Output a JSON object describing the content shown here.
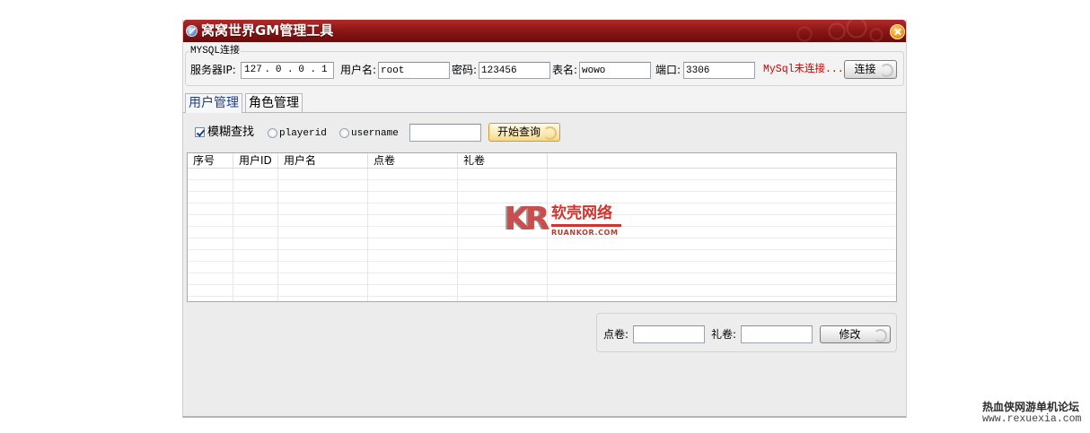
{
  "window": {
    "title": "窝窝世界GM管理工具",
    "icon": "app-icon",
    "close_icon": "close-icon"
  },
  "mysql": {
    "group_label": "MYSQL连接",
    "server_ip_label": "服务器IP:",
    "ip_octets": [
      "127",
      "0",
      "0",
      "1"
    ],
    "ip_separator": ".",
    "username_label": "用户名:",
    "username_value": "root",
    "password_label": "密码:",
    "password_value": "123456",
    "table_label": "表名:",
    "table_value": "wowo",
    "port_label": "端口:",
    "port_value": "3306",
    "status_text": "MySql未连接...",
    "connect_button": "连接"
  },
  "tabs": [
    {
      "label": "用户管理",
      "selected": true
    },
    {
      "label": "角色管理",
      "selected": false
    }
  ],
  "search": {
    "fuzzy_label": "模糊查找",
    "fuzzy_checked": true,
    "playerid_label": "playerid",
    "playerid_selected": false,
    "username_label": "username",
    "username_selected": false,
    "query_value": "",
    "search_button": "开始查询"
  },
  "table": {
    "columns": [
      "序号",
      "用户ID",
      "用户名",
      "点卷",
      "礼卷"
    ],
    "rows": []
  },
  "edit": {
    "points_label": "点卷:",
    "points_value": "",
    "gift_label": "礼卷:",
    "gift_value": "",
    "modify_button": "修改"
  },
  "watermarks": {
    "center_logo_mark": "KR",
    "center_logo_name": "软壳网络",
    "center_logo_domain": "RUANKOR.COM",
    "corner_site_name": "热血侠网游单机论坛",
    "corner_site_url": "www.rexuexia.com"
  },
  "colors": {
    "titlebar": "#8e1717",
    "status_text": "#cc0000",
    "selected_tab_text": "#1d3f8a",
    "watermark_red": "#d2332f"
  }
}
